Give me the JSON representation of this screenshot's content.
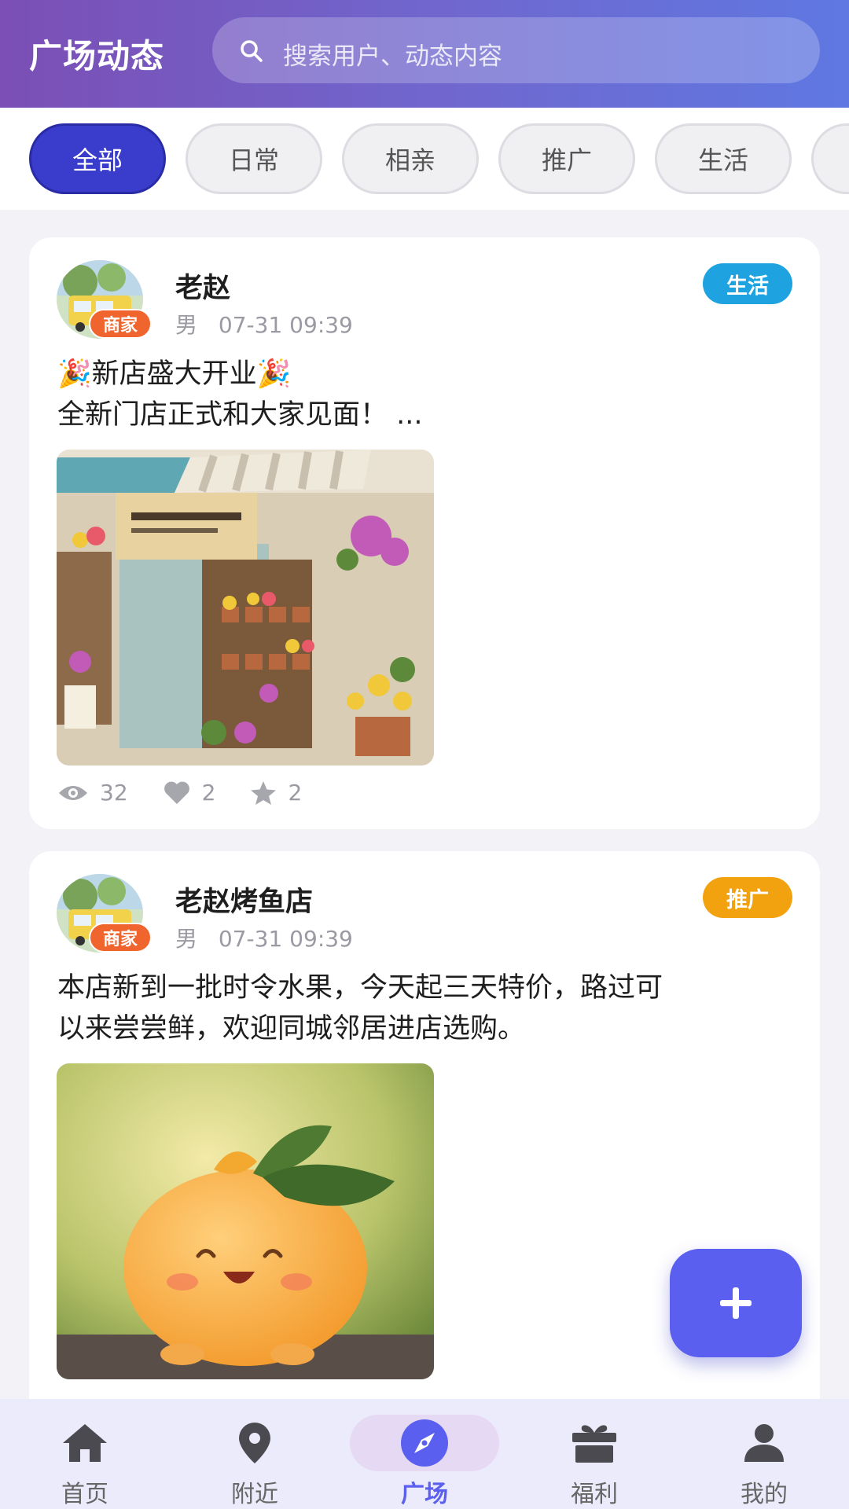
{
  "header": {
    "title": "广场动态",
    "search_placeholder": "搜索用户、动态内容"
  },
  "categories": {
    "items": [
      "全部",
      "日常",
      "相亲",
      "推广",
      "生活"
    ],
    "active": "全部"
  },
  "posts": [
    {
      "user_name": "老赵",
      "badge": "商家",
      "gender": "男",
      "time": "07-31 09:39",
      "tag": "生活",
      "tag_color": "#1ea3e0",
      "text_line1": "🎉新店盛大开业🎉",
      "text_line2": "全新门店正式和大家见面！ ...",
      "image_icon": "flower-shop-photo",
      "views": "32",
      "likes": "2",
      "favorites": "2"
    },
    {
      "user_name": "老赵烤鱼店",
      "badge": "商家",
      "gender": "男",
      "time": "07-31 09:39",
      "tag": "推广",
      "tag_color": "#f2a20f",
      "text_line1": "本店新到一批时令水果，今天起三天特价，路过可",
      "text_line2": "以来尝尝鲜，欢迎同城邻居进店选购。",
      "image_icon": "orange-character-photo"
    }
  ],
  "fab": {
    "icon": "plus-icon"
  },
  "bottom_nav": {
    "items": [
      {
        "label": "首页",
        "icon": "home-icon"
      },
      {
        "label": "附近",
        "icon": "location-pin-icon"
      },
      {
        "label": "广场",
        "icon": "compass-icon"
      },
      {
        "label": "福利",
        "icon": "gift-icon"
      },
      {
        "label": "我的",
        "icon": "user-icon"
      }
    ],
    "active": "广场"
  },
  "colors": {
    "accent": "#5a5ff0",
    "chip_active": "#3a3ccc",
    "merchant_badge": "#f0642e"
  }
}
